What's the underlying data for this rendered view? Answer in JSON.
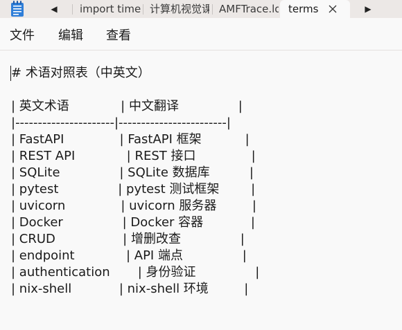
{
  "tabs": {
    "items": [
      {
        "label": "import time("
      },
      {
        "label": "计算机视觉课"
      },
      {
        "label": "AMFTrace.log"
      }
    ],
    "active": {
      "label": "terms"
    }
  },
  "menu": {
    "file": "文件",
    "edit": "编辑",
    "view": "查看"
  },
  "editor": {
    "lines": [
      "# 术语对照表（中英文）",
      "",
      "| 英文术语             | 中文翻译               |",
      "|----------------------|------------------------|",
      "| FastAPI              | FastAPI 框架           |",
      "| REST API             | REST 接口              |",
      "| SQLite               | SQLite 数据库          |",
      "| pytest               | pytest 测试框架        |",
      "| uvicorn              | uvicorn 服务器         |",
      "| Docker               | Docker 容器            |",
      "| CRUD                 | 增删改查               |",
      "| endpoint             | API 端点               |",
      "| authentication       | 身份验证               |",
      "| nix-shell            | nix-shell 环境         |"
    ]
  },
  "icons": {
    "app": "notepad-icon",
    "back": "chevron-left-icon",
    "forward": "chevron-right-icon",
    "close": "close-icon"
  },
  "colors": {
    "tabbar": "#ece8e6",
    "editor_bg": "#f9f9f9",
    "text": "#1a1a1a"
  }
}
